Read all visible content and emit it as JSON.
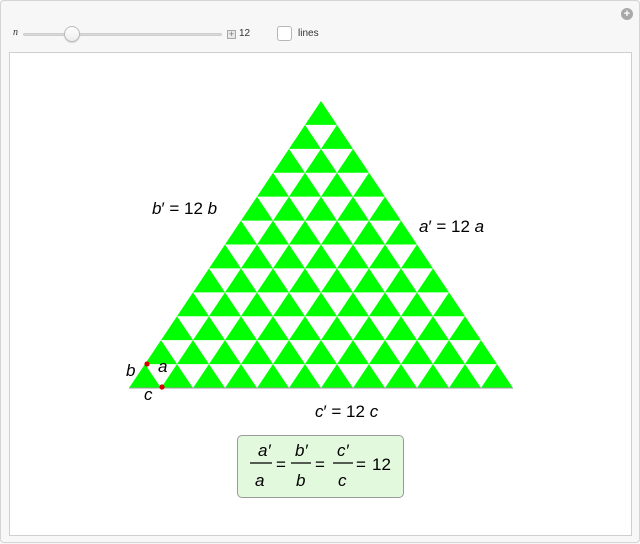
{
  "controls": {
    "n_label": "n",
    "n_value": "12",
    "n_slider_level": 12,
    "lines_label": "lines",
    "lines_checked": false
  },
  "figure": {
    "n": 12,
    "big_fill": "#00ff00",
    "hole_fill": "#ffffff",
    "point_color": "#d40000",
    "labels": {
      "b_prime": "b′ = 12 b",
      "a_prime": "a′ = 12 a",
      "c_prime": "c′ = 12 c",
      "small_b": "b",
      "small_a": "a",
      "small_c": "c"
    },
    "ratio": {
      "a_num": "a′",
      "a_den": "a",
      "b_num": "b′",
      "b_den": "b",
      "c_num": "c′",
      "c_den": "c",
      "eq": "=",
      "value": "12"
    }
  }
}
